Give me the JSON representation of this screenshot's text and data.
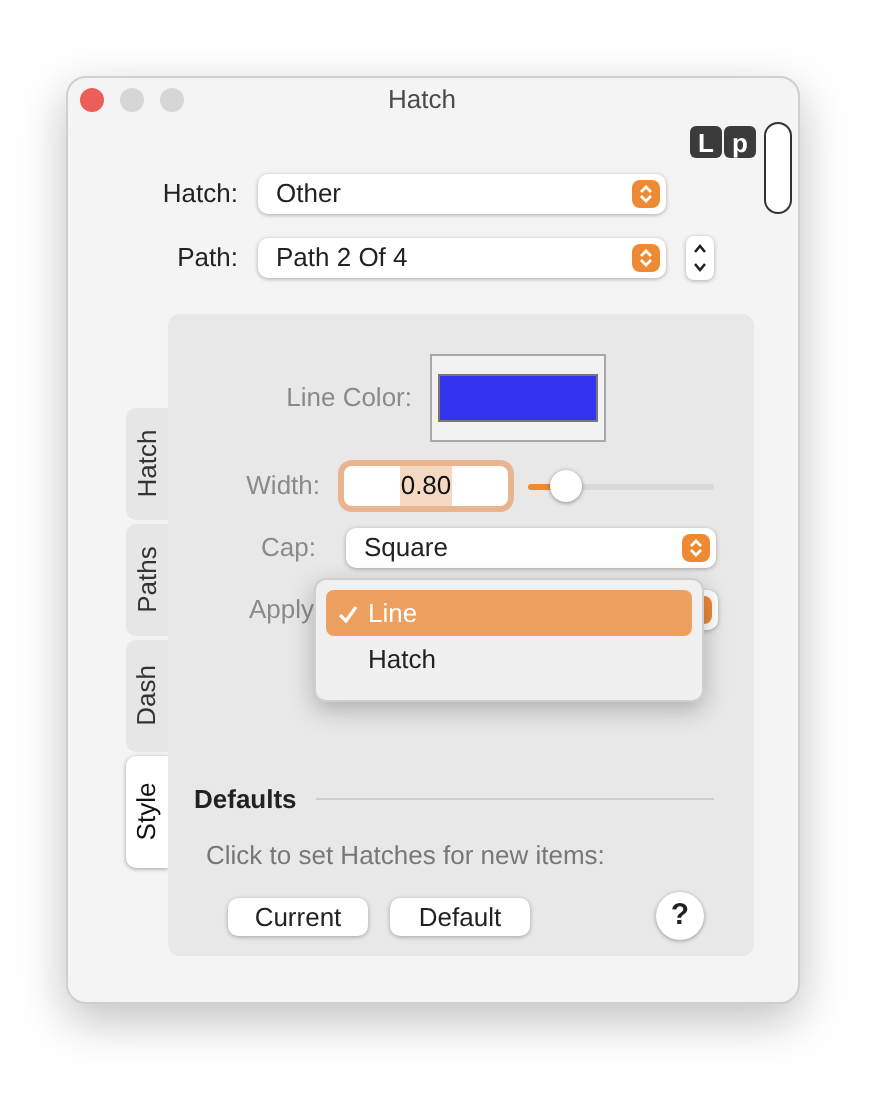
{
  "window": {
    "title": "Hatch"
  },
  "logo": [
    "L",
    "p"
  ],
  "hatch": {
    "label": "Hatch:",
    "value": "Other"
  },
  "path": {
    "label": "Path:",
    "value": "Path 2 Of 4"
  },
  "tabs": [
    {
      "label": "Hatch",
      "selected": false
    },
    {
      "label": "Paths",
      "selected": false
    },
    {
      "label": "Dash",
      "selected": false
    },
    {
      "label": "Style",
      "selected": true
    }
  ],
  "line_color": {
    "label": "Line Color:",
    "color": "#3333ee"
  },
  "width": {
    "label": "Width:",
    "value": "0.80",
    "focused": true,
    "level": 0.2
  },
  "cap": {
    "label": "Cap:",
    "value": "Square"
  },
  "apply": {
    "label": "Apply",
    "menu": [
      {
        "label": "Line",
        "selected": true
      },
      {
        "label": "Hatch",
        "selected": false
      }
    ]
  },
  "defaults": {
    "title": "Defaults",
    "hint": "Click to set Hatches for new items:",
    "buttons": [
      "Current",
      "Default"
    ],
    "help": "?"
  }
}
